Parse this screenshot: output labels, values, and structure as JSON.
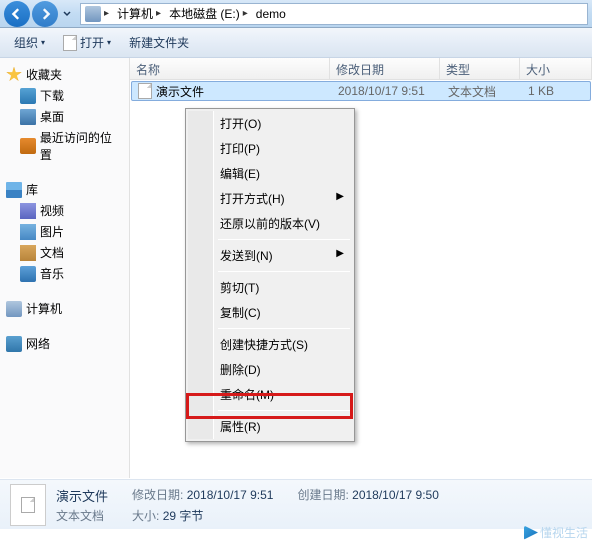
{
  "breadcrumb": {
    "items": [
      {
        "label": "计算机"
      },
      {
        "label": "本地磁盘 (E:)"
      },
      {
        "label": "demo"
      }
    ]
  },
  "toolbar": {
    "organize": "组织",
    "open": "打开",
    "newfolder": "新建文件夹"
  },
  "sidebar": {
    "favorites": {
      "title": "收藏夹",
      "items": [
        "下载",
        "桌面",
        "最近访问的位置"
      ]
    },
    "libraries": {
      "title": "库",
      "items": [
        "视频",
        "图片",
        "文档",
        "音乐"
      ]
    },
    "computer": {
      "title": "计算机"
    },
    "network": {
      "title": "网络"
    }
  },
  "columns": {
    "name": "名称",
    "date": "修改日期",
    "type": "类型",
    "size": "大小"
  },
  "files": [
    {
      "name": "演示文件",
      "date": "2018/10/17 9:51",
      "type": "文本文档",
      "size": "1 KB"
    }
  ],
  "contextmenu": {
    "open": "打开(O)",
    "print": "打印(P)",
    "edit": "编辑(E)",
    "openwith": "打开方式(H)",
    "restore": "还原以前的版本(V)",
    "sendto": "发送到(N)",
    "cut": "剪切(T)",
    "copy": "复制(C)",
    "shortcut": "创建快捷方式(S)",
    "delete": "删除(D)",
    "rename": "重命名(M)",
    "properties": "属性(R)"
  },
  "details": {
    "filename": "演示文件",
    "modified_label": "修改日期:",
    "modified_value": "2018/10/17 9:51",
    "created_label": "创建日期:",
    "created_value": "2018/10/17 9:50",
    "type_label": "文本文档",
    "size_label": "大小:",
    "size_value": "29 字节"
  },
  "watermark": "懂视生活"
}
